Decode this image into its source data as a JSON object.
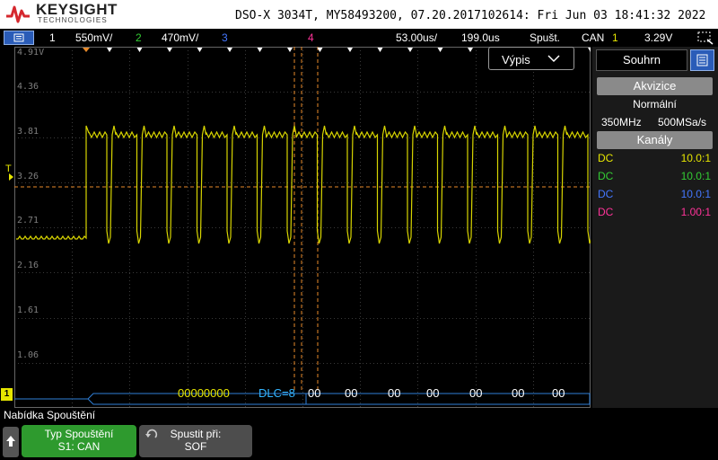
{
  "header": {
    "brand": "KEYSIGHT",
    "brand_sub": "TECHNOLOGIES",
    "device_info": "DSO-X 3034T, MY58493200, 07.20.2017102614: Fri Jun 03 18:41:32 2022"
  },
  "status": {
    "ch1_num": "1",
    "ch1_scale": "550mV/",
    "ch2_num": "2",
    "ch2_scale": "470mV/",
    "ch3_num": "3",
    "ch4_num": "4",
    "timebase": "53.00us/",
    "delay": "199.0us",
    "run_state": "Spušt.",
    "trigger_type": "CAN",
    "trigger_ch": "1",
    "trigger_level": "3.29V"
  },
  "colors": {
    "ch1": "#e6e600",
    "ch2": "#33cc33",
    "ch3": "#4477ff",
    "ch4": "#ff3399",
    "cursor": "#e88a2a",
    "bus": "#2f7fd8"
  },
  "screen": {
    "y_labels": [
      "4.91V",
      "4.36",
      "3.81",
      "3.26",
      "2.71",
      "2.16",
      "1.61",
      "1.06"
    ],
    "trigger_marker": "T",
    "ground_marker": "1",
    "vypis_button": "Výpis"
  },
  "bus_decode": {
    "id": "00000000",
    "dlc": "DLC=8",
    "bytes": [
      "00",
      "00",
      "00",
      "00",
      "00",
      "00",
      "00"
    ]
  },
  "right_panel": {
    "tab_label": "Souhrn",
    "acquisition_header": "Akvizice",
    "acquisition_mode": "Normální",
    "bandwidth": "350MHz",
    "sample_rate": "500MSa/s",
    "channels_header": "Kanály",
    "channels": [
      {
        "coupling": "DC",
        "probe": "10.0:1",
        "color": "#e6e600"
      },
      {
        "coupling": "DC",
        "probe": "10.0:1",
        "color": "#33cc33"
      },
      {
        "coupling": "DC",
        "probe": "10.0:1",
        "color": "#4477ff"
      },
      {
        "coupling": "DC",
        "probe": "1.00:1",
        "color": "#ff3399"
      }
    ]
  },
  "softkeys": {
    "menu_title": "Nabídka Spouštění",
    "key1_title": "Typ Spouštění",
    "key1_value": "S1: CAN",
    "key2_title": "Spustit při:",
    "key2_value": "SOF"
  }
}
